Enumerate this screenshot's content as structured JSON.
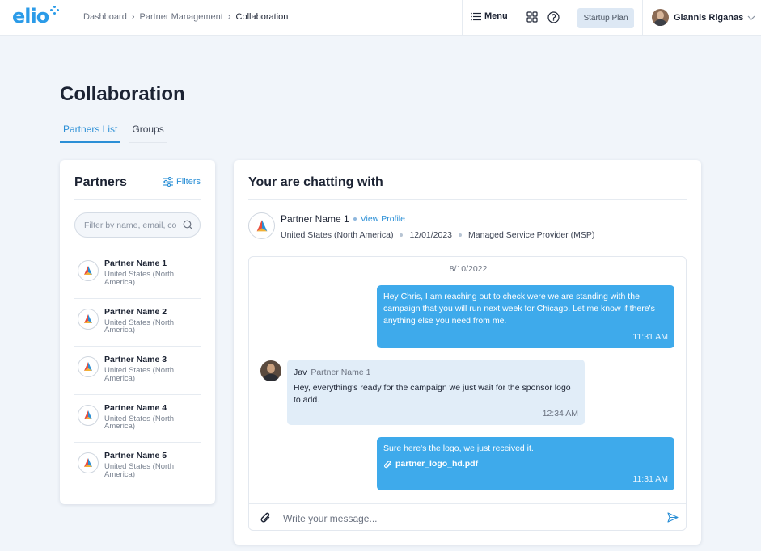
{
  "app": {
    "logo_text": "elio"
  },
  "breadcrumb": [
    "Dashboard",
    "Partner Management",
    "Collaboration"
  ],
  "header": {
    "menu_label": "Menu",
    "plan_label": "Startup Plan",
    "user_name": "Giannis Riganas"
  },
  "page": {
    "title": "Collaboration",
    "tabs": [
      {
        "label": "Partners List",
        "active": true
      },
      {
        "label": "Groups",
        "active": false
      }
    ]
  },
  "partners_panel": {
    "title": "Partners",
    "filters_label": "Filters",
    "search_placeholder": "Filter by name, email, co",
    "items": [
      {
        "name": "Partner Name 1",
        "location": "United States (North America)"
      },
      {
        "name": "Partner Name 2",
        "location": "United States (North America)"
      },
      {
        "name": "Partner Name 3",
        "location": "United States (North America)"
      },
      {
        "name": "Partner Name 4",
        "location": "United States (North America)"
      },
      {
        "name": "Partner Name 5",
        "location": "United States (North America)"
      }
    ]
  },
  "chat": {
    "title": "Your are chatting with",
    "partner": {
      "name": "Partner Name 1",
      "view_profile_label": "View Profile",
      "location": "United States (North America)",
      "date": "12/01/2023",
      "type": "Managed Service Provider (MSP)"
    },
    "date_divider": "8/10/2022",
    "messages": [
      {
        "direction": "outgoing",
        "text": "Hey Chris, I am reaching out to check were we are standing with the campaign that you will run next week for Chicago. Let me know if there's anything else you need from me.",
        "time": "11:31 AM"
      },
      {
        "direction": "incoming",
        "sender": "Jav",
        "sender_role": "Partner Name 1",
        "text": "Hey, everything's ready for the campaign we just wait for the sponsor logo to add.",
        "time": "12:34 AM"
      },
      {
        "direction": "outgoing",
        "text": "Sure here's the logo, we just received it.",
        "attachment": "partner_logo_hd.pdf",
        "time": "11:31 AM"
      }
    ],
    "composer_placeholder": "Write your message..."
  },
  "colors": {
    "accent": "#2b8fd6",
    "outgoing_bubble": "#3eaaeb",
    "incoming_bubble": "#e1edf8",
    "page_bg": "#f1f5fa"
  },
  "icons": {
    "menu": "hamburger-icon",
    "apps": "grid-icon",
    "help": "question-circle-icon",
    "filters": "sliders-icon",
    "search": "search-icon",
    "attach": "paperclip-icon",
    "send": "send-icon"
  }
}
